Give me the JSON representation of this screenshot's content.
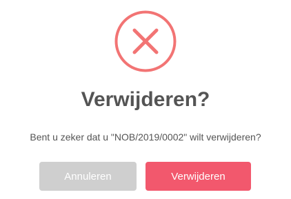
{
  "dialog": {
    "icon": "error-x-circle-icon",
    "title": "Verwijderen?",
    "message": "Bent u zeker dat u \"NOB/2019/0002\" wilt verwijderen?",
    "cancel_label": "Annuleren",
    "confirm_label": "Verwijderen"
  },
  "colors": {
    "icon": "#f27474",
    "title_text": "#545454",
    "cancel_button": "#cfcfcf",
    "confirm_button": "#f2586d",
    "background": "#ffffff"
  }
}
